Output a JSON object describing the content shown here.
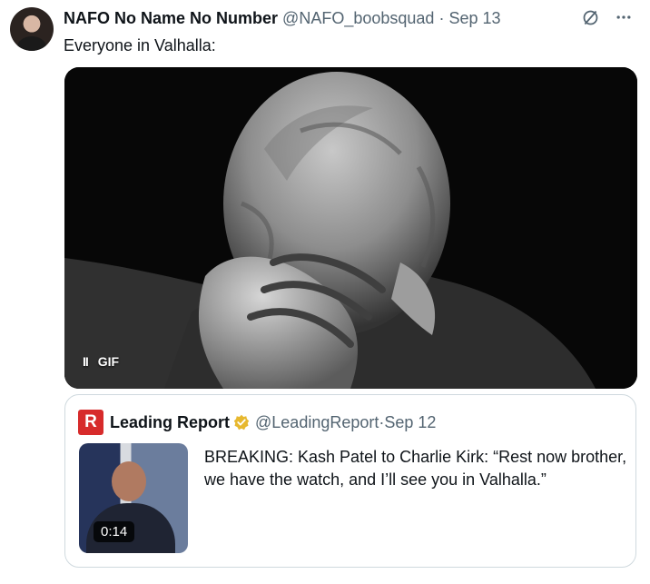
{
  "tweet": {
    "author_name": "NAFO No Name No Number",
    "handle": "@NAFO_boobsquad",
    "separator": "·",
    "date": "Sep 13",
    "text": "Everyone in Valhalla:",
    "media": {
      "type": "GIF",
      "label": "GIF",
      "control": "pause"
    }
  },
  "quote": {
    "author_name": "Leading Report",
    "handle": "@LeadingReport",
    "separator": "·",
    "date": "Sep 12",
    "text": "BREAKING: Kash Patel to Charlie Kirk: “Rest now brother, we have the watch, and I’ll see you in Valhalla.”",
    "video_duration": "0:14"
  },
  "colors": {
    "text": "#0f1419",
    "muted": "#536471",
    "border": "#cfd9de",
    "verified": "#e7b82f",
    "brand_red": "#d72b2b"
  },
  "icons": [
    "grok-icon",
    "more-icon",
    "pause-icon",
    "leading-report-logo",
    "verified-badge-icon"
  ]
}
